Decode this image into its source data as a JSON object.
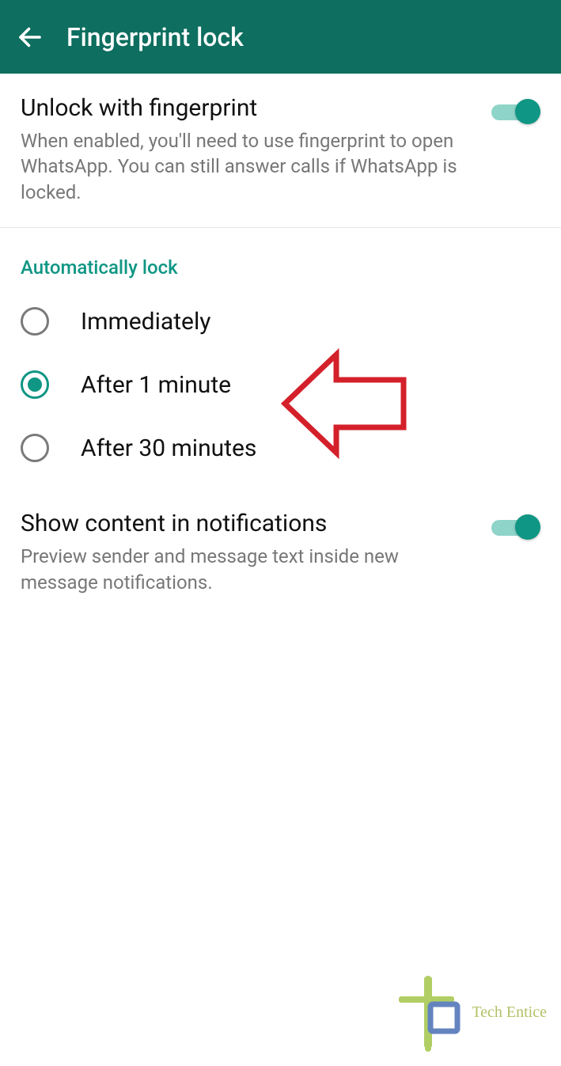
{
  "header": {
    "title": "Fingerprint lock"
  },
  "unlock": {
    "title": "Unlock with fingerprint",
    "subtitle": "When enabled, you'll need to use fingerprint to open WhatsApp. You can still answer calls if WhatsApp is locked.",
    "enabled": true
  },
  "auto_lock": {
    "title": "Automatically lock",
    "options": [
      {
        "label": "Immediately",
        "selected": false
      },
      {
        "label": "After 1 minute",
        "selected": true
      },
      {
        "label": "After 30 minutes",
        "selected": false
      }
    ]
  },
  "notifications": {
    "title": "Show content in notifications",
    "subtitle": "Preview sender and message text inside new message notifications.",
    "enabled": true
  },
  "watermark": {
    "text": "Tech Entice"
  }
}
